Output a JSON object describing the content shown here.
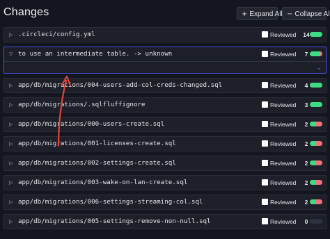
{
  "header": {
    "title": "Changes",
    "expand_all": "Expand All",
    "collapse_all": "Collapse All",
    "expand_icon": "+",
    "collapse_icon": "−"
  },
  "colors": {
    "added": "#3ddc84",
    "deleted": "#f2737a",
    "accent": "#4a56e0"
  },
  "files": [
    {
      "path": ".circleci/config.yml",
      "reviewed_label": "Reviewed",
      "count": "14",
      "add_fraction": 1.0,
      "del_fraction": 0.0,
      "expanded": false
    },
    {
      "path": "to use an intermediate table. -> unknown",
      "reviewed_label": "Reviewed",
      "count": "7",
      "add_fraction": 0.85,
      "del_fraction": 0.15,
      "expanded": true
    },
    {
      "path": "app/db/migrations/004-users-add-col-creds-changed.sql",
      "reviewed_label": "Reviewed",
      "count": "4",
      "add_fraction": 1.0,
      "del_fraction": 0.0,
      "expanded": false
    },
    {
      "path": "app/db/migrations/.sqlfluffignore",
      "reviewed_label": "Reviewed",
      "count": "3",
      "add_fraction": 1.0,
      "del_fraction": 0.0,
      "expanded": false
    },
    {
      "path": "app/db/migrations/000-users-create.sql",
      "reviewed_label": "Reviewed",
      "count": "2",
      "add_fraction": 0.5,
      "del_fraction": 0.5,
      "expanded": false
    },
    {
      "path": "app/db/migrations/001-licenses-create.sql",
      "reviewed_label": "Reviewed",
      "count": "2",
      "add_fraction": 0.5,
      "del_fraction": 0.5,
      "expanded": false
    },
    {
      "path": "app/db/migrations/002-settings-create.sql",
      "reviewed_label": "Reviewed",
      "count": "2",
      "add_fraction": 0.5,
      "del_fraction": 0.5,
      "expanded": false
    },
    {
      "path": "app/db/migrations/003-wake-on-lan-create.sql",
      "reviewed_label": "Reviewed",
      "count": "2",
      "add_fraction": 0.5,
      "del_fraction": 0.5,
      "expanded": false
    },
    {
      "path": "app/db/migrations/006-settings-streaming-col.sql",
      "reviewed_label": "Reviewed",
      "count": "2",
      "add_fraction": 0.5,
      "del_fraction": 0.5,
      "expanded": false
    },
    {
      "path": "app/db/migrations/005-settings-remove-non-null.sql",
      "reviewed_label": "Reviewed",
      "count": "0",
      "add_fraction": 0.0,
      "del_fraction": 0.0,
      "expanded": false
    }
  ]
}
